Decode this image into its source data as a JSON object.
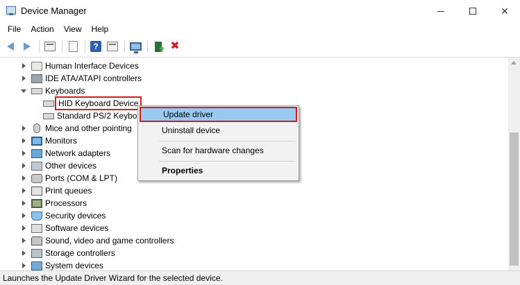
{
  "window": {
    "title": "Device Manager",
    "app_icon": "device-manager-icon",
    "controls": [
      "minimize",
      "maximize",
      "close"
    ]
  },
  "menu": [
    "File",
    "Action",
    "View",
    "Help"
  ],
  "toolbar": {
    "icons": [
      "back-icon",
      "forward-icon",
      "show-hide-console-tree-icon",
      "properties-icon",
      "help-icon",
      "action-pane-icon",
      "scan-hardware-icon",
      "update-driver-icon",
      "uninstall-icon"
    ]
  },
  "tree": {
    "items": [
      {
        "label": "Human Interface Devices",
        "level": 1,
        "expanded": false,
        "icon": "hid-icon"
      },
      {
        "label": "IDE ATA/ATAPI controllers",
        "level": 1,
        "expanded": false,
        "icon": "ide-controller-icon"
      },
      {
        "label": "Keyboards",
        "level": 1,
        "expanded": true,
        "icon": "keyboard-icon"
      },
      {
        "label": "HID Keyboard Device",
        "level": 2,
        "selected": true,
        "icon": "keyboard-icon"
      },
      {
        "label": "Standard PS/2 Keyboa",
        "level": 2,
        "icon": "keyboard-icon"
      },
      {
        "label": "Mice and other pointing",
        "level": 1,
        "expanded": false,
        "icon": "mouse-icon"
      },
      {
        "label": "Monitors",
        "level": 1,
        "expanded": false,
        "icon": "monitor-icon"
      },
      {
        "label": "Network adapters",
        "level": 1,
        "expanded": false,
        "icon": "network-adapter-icon"
      },
      {
        "label": "Other devices",
        "level": 1,
        "expanded": false,
        "icon": "other-devices-icon"
      },
      {
        "label": "Ports (COM & LPT)",
        "level": 1,
        "expanded": false,
        "icon": "ports-icon"
      },
      {
        "label": "Print queues",
        "level": 1,
        "expanded": false,
        "icon": "printer-icon"
      },
      {
        "label": "Processors",
        "level": 1,
        "expanded": false,
        "icon": "processor-icon"
      },
      {
        "label": "Security devices",
        "level": 1,
        "expanded": false,
        "icon": "security-device-icon"
      },
      {
        "label": "Software devices",
        "level": 1,
        "expanded": false,
        "icon": "software-device-icon"
      },
      {
        "label": "Sound, video and game controllers",
        "level": 1,
        "expanded": false,
        "icon": "sound-icon"
      },
      {
        "label": "Storage controllers",
        "level": 1,
        "expanded": false,
        "icon": "storage-controller-icon"
      },
      {
        "label": "System devices",
        "level": 1,
        "expanded": false,
        "icon": "system-device-icon"
      }
    ]
  },
  "context_menu": {
    "items": [
      {
        "label": "Update driver",
        "highlighted": true
      },
      {
        "label": "Uninstall device"
      },
      {
        "label": "Scan for hardware changes"
      },
      {
        "label": "Properties",
        "bold": true
      }
    ]
  },
  "status": {
    "text": "Launches the Update Driver Wizard for the selected device."
  },
  "colors": {
    "highlight": "#99c9ef",
    "annotation": "#d01c1c"
  }
}
